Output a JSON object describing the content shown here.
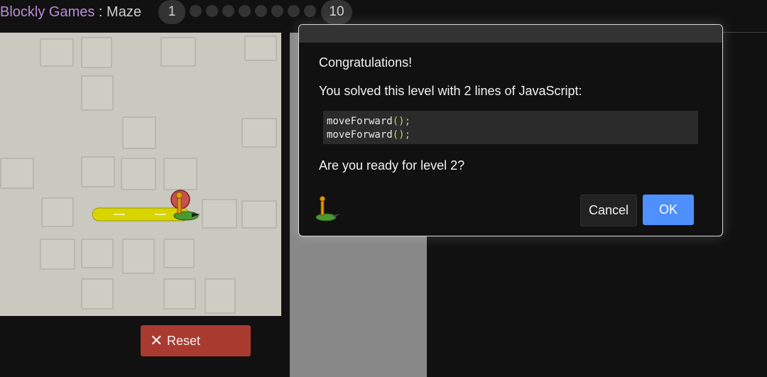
{
  "header": {
    "app_name": "Blockly Games",
    "separator": " : ",
    "game_name": "Maze",
    "level_first": "1",
    "level_last": "10"
  },
  "controls": {
    "reset_label": "Reset",
    "reset_icon": "close-icon"
  },
  "dialog": {
    "heading": "Congratulations!",
    "message": "You solved this level with 2 lines of JavaScript:",
    "code_lines": [
      {
        "fn": "moveForward",
        "args": "();"
      },
      {
        "fn": "moveForward",
        "args": "();"
      }
    ],
    "question": "Are you ready for level 2?",
    "cancel_label": "Cancel",
    "ok_label": "OK"
  },
  "colors": {
    "accent_blue": "#4d90fe",
    "reset_red": "#a83a30",
    "app_name_purple": "#b98ed6",
    "path_yellow": "#d8d400"
  }
}
